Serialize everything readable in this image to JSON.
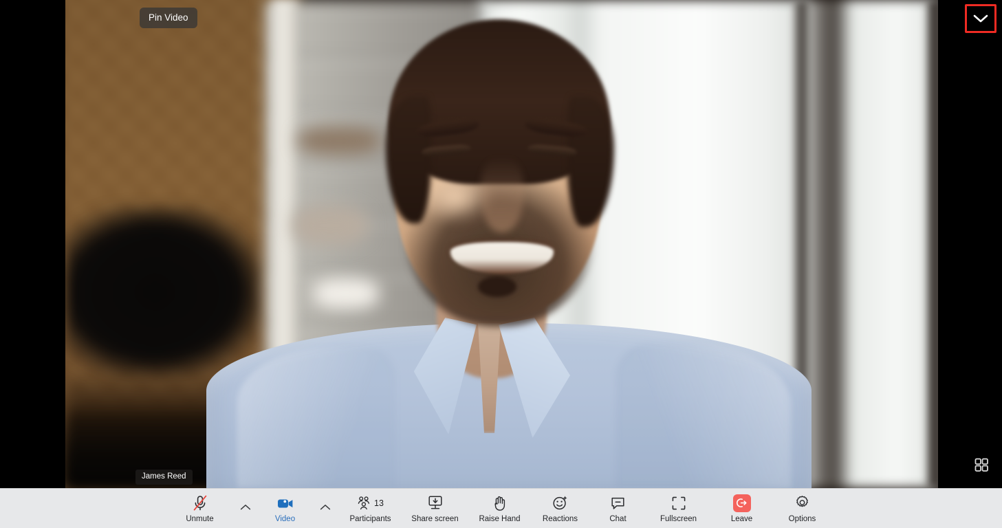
{
  "app": {
    "type": "video-conference",
    "stage_background": "#000000",
    "toolbar_background": "#e7e8ea",
    "accent_color": "#2a6ebb",
    "leave_color": "#f4625c",
    "highlight_color": "#ef2b23"
  },
  "video": {
    "pin_label": "Pin Video",
    "participant_name": "James Reed",
    "collapse_icon": "chevron-down-icon",
    "grid_view_icon": "grid-view-icon"
  },
  "toolbar": {
    "items": [
      {
        "id": "mute",
        "label": "Unmute",
        "icon": "microphone-muted-icon",
        "active": false,
        "has_caret": true,
        "count": null
      },
      {
        "id": "video",
        "label": "Video",
        "icon": "camera-icon",
        "active": true,
        "has_caret": true,
        "count": null
      },
      {
        "id": "participants",
        "label": "Participants",
        "icon": "participants-icon",
        "active": false,
        "has_caret": false,
        "count": "13"
      },
      {
        "id": "share-screen",
        "label": "Share screen",
        "icon": "share-screen-icon",
        "active": false,
        "has_caret": false,
        "count": null
      },
      {
        "id": "raise-hand",
        "label": "Raise Hand",
        "icon": "raise-hand-icon",
        "active": false,
        "has_caret": false,
        "count": null
      },
      {
        "id": "reactions",
        "label": "Reactions",
        "icon": "reactions-icon",
        "active": false,
        "has_caret": false,
        "count": null
      },
      {
        "id": "chat",
        "label": "Chat",
        "icon": "chat-icon",
        "active": false,
        "has_caret": false,
        "count": null
      },
      {
        "id": "fullscreen",
        "label": "Fullscreen",
        "icon": "fullscreen-icon",
        "active": false,
        "has_caret": false,
        "count": null
      },
      {
        "id": "leave",
        "label": "Leave",
        "icon": "leave-icon",
        "active": false,
        "has_caret": false,
        "count": null
      },
      {
        "id": "options",
        "label": "Options",
        "icon": "gear-icon",
        "active": false,
        "has_caret": false,
        "count": null
      }
    ]
  }
}
